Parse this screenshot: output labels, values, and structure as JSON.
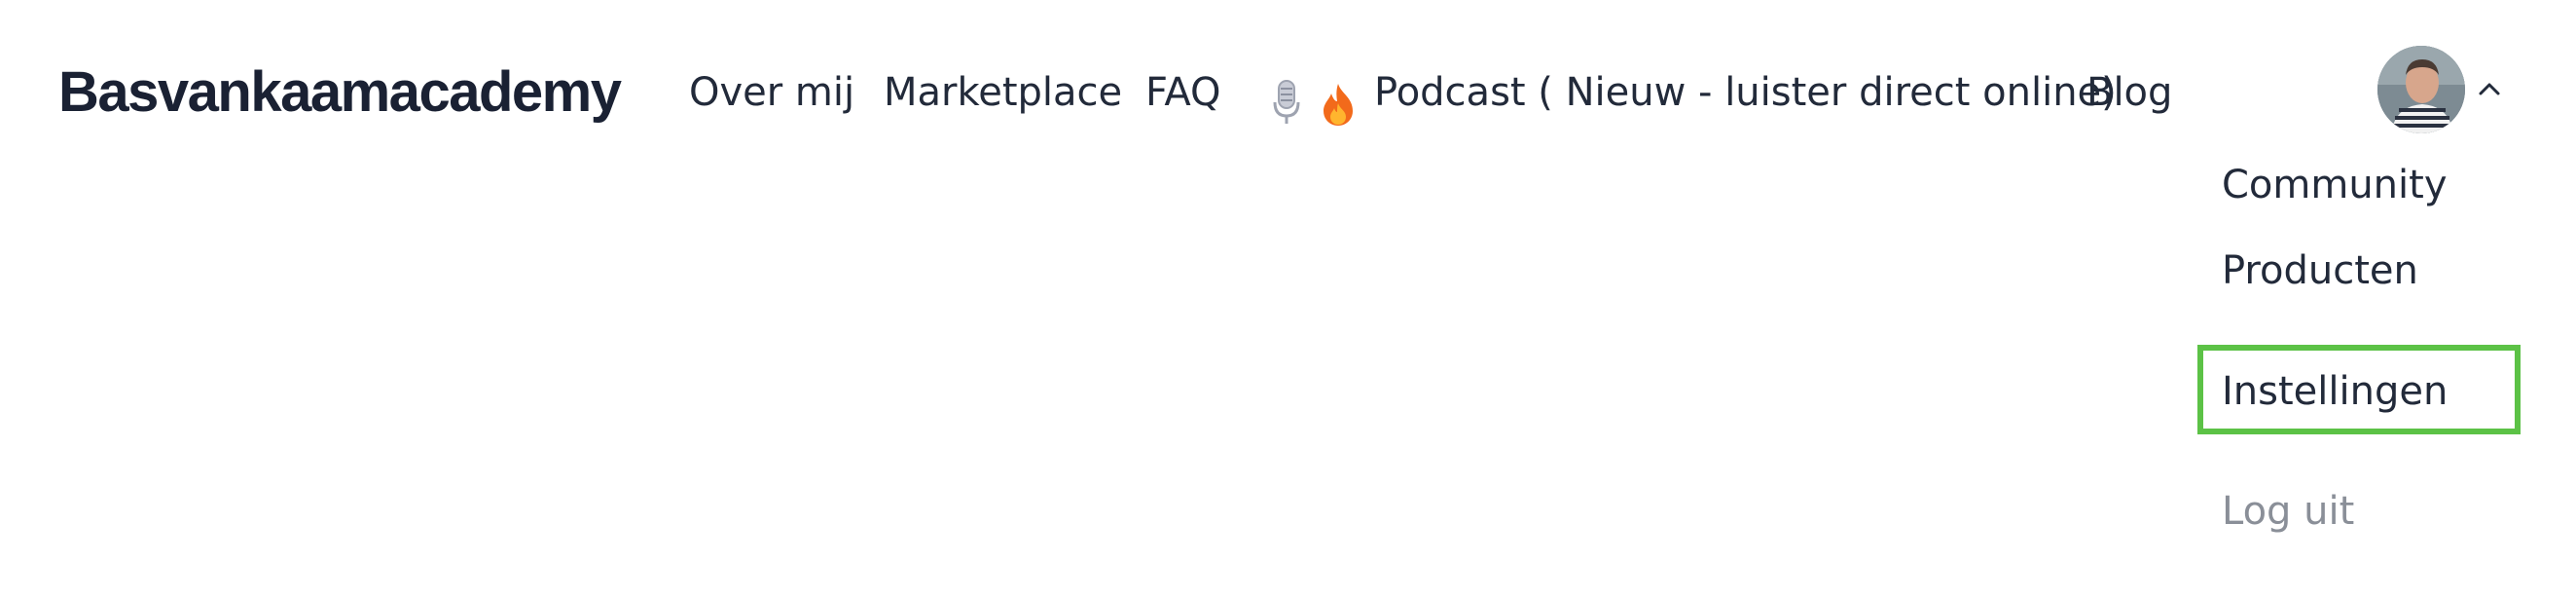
{
  "brand": {
    "name": "Basvankaamacademy"
  },
  "nav": {
    "items": [
      {
        "label": "Over mij"
      },
      {
        "label": "Marketplace"
      },
      {
        "label": "FAQ"
      },
      {
        "label": "Podcast ( Nieuw - luister direct online)",
        "icons": [
          "microphone-icon",
          "fire-icon"
        ]
      },
      {
        "label": "Blog"
      }
    ]
  },
  "user_menu": {
    "avatar_icon": "avatar",
    "chevron_icon": "chevron-up-icon",
    "items": [
      {
        "label": "Community"
      },
      {
        "label": "Producten"
      },
      {
        "label": "Instellingen",
        "highlighted": true
      },
      {
        "label": "Log uit"
      }
    ]
  },
  "colors": {
    "text": "#222a3a",
    "brand": "#1a2133",
    "muted": "#8a8f98",
    "highlight_border": "#5cc246"
  }
}
